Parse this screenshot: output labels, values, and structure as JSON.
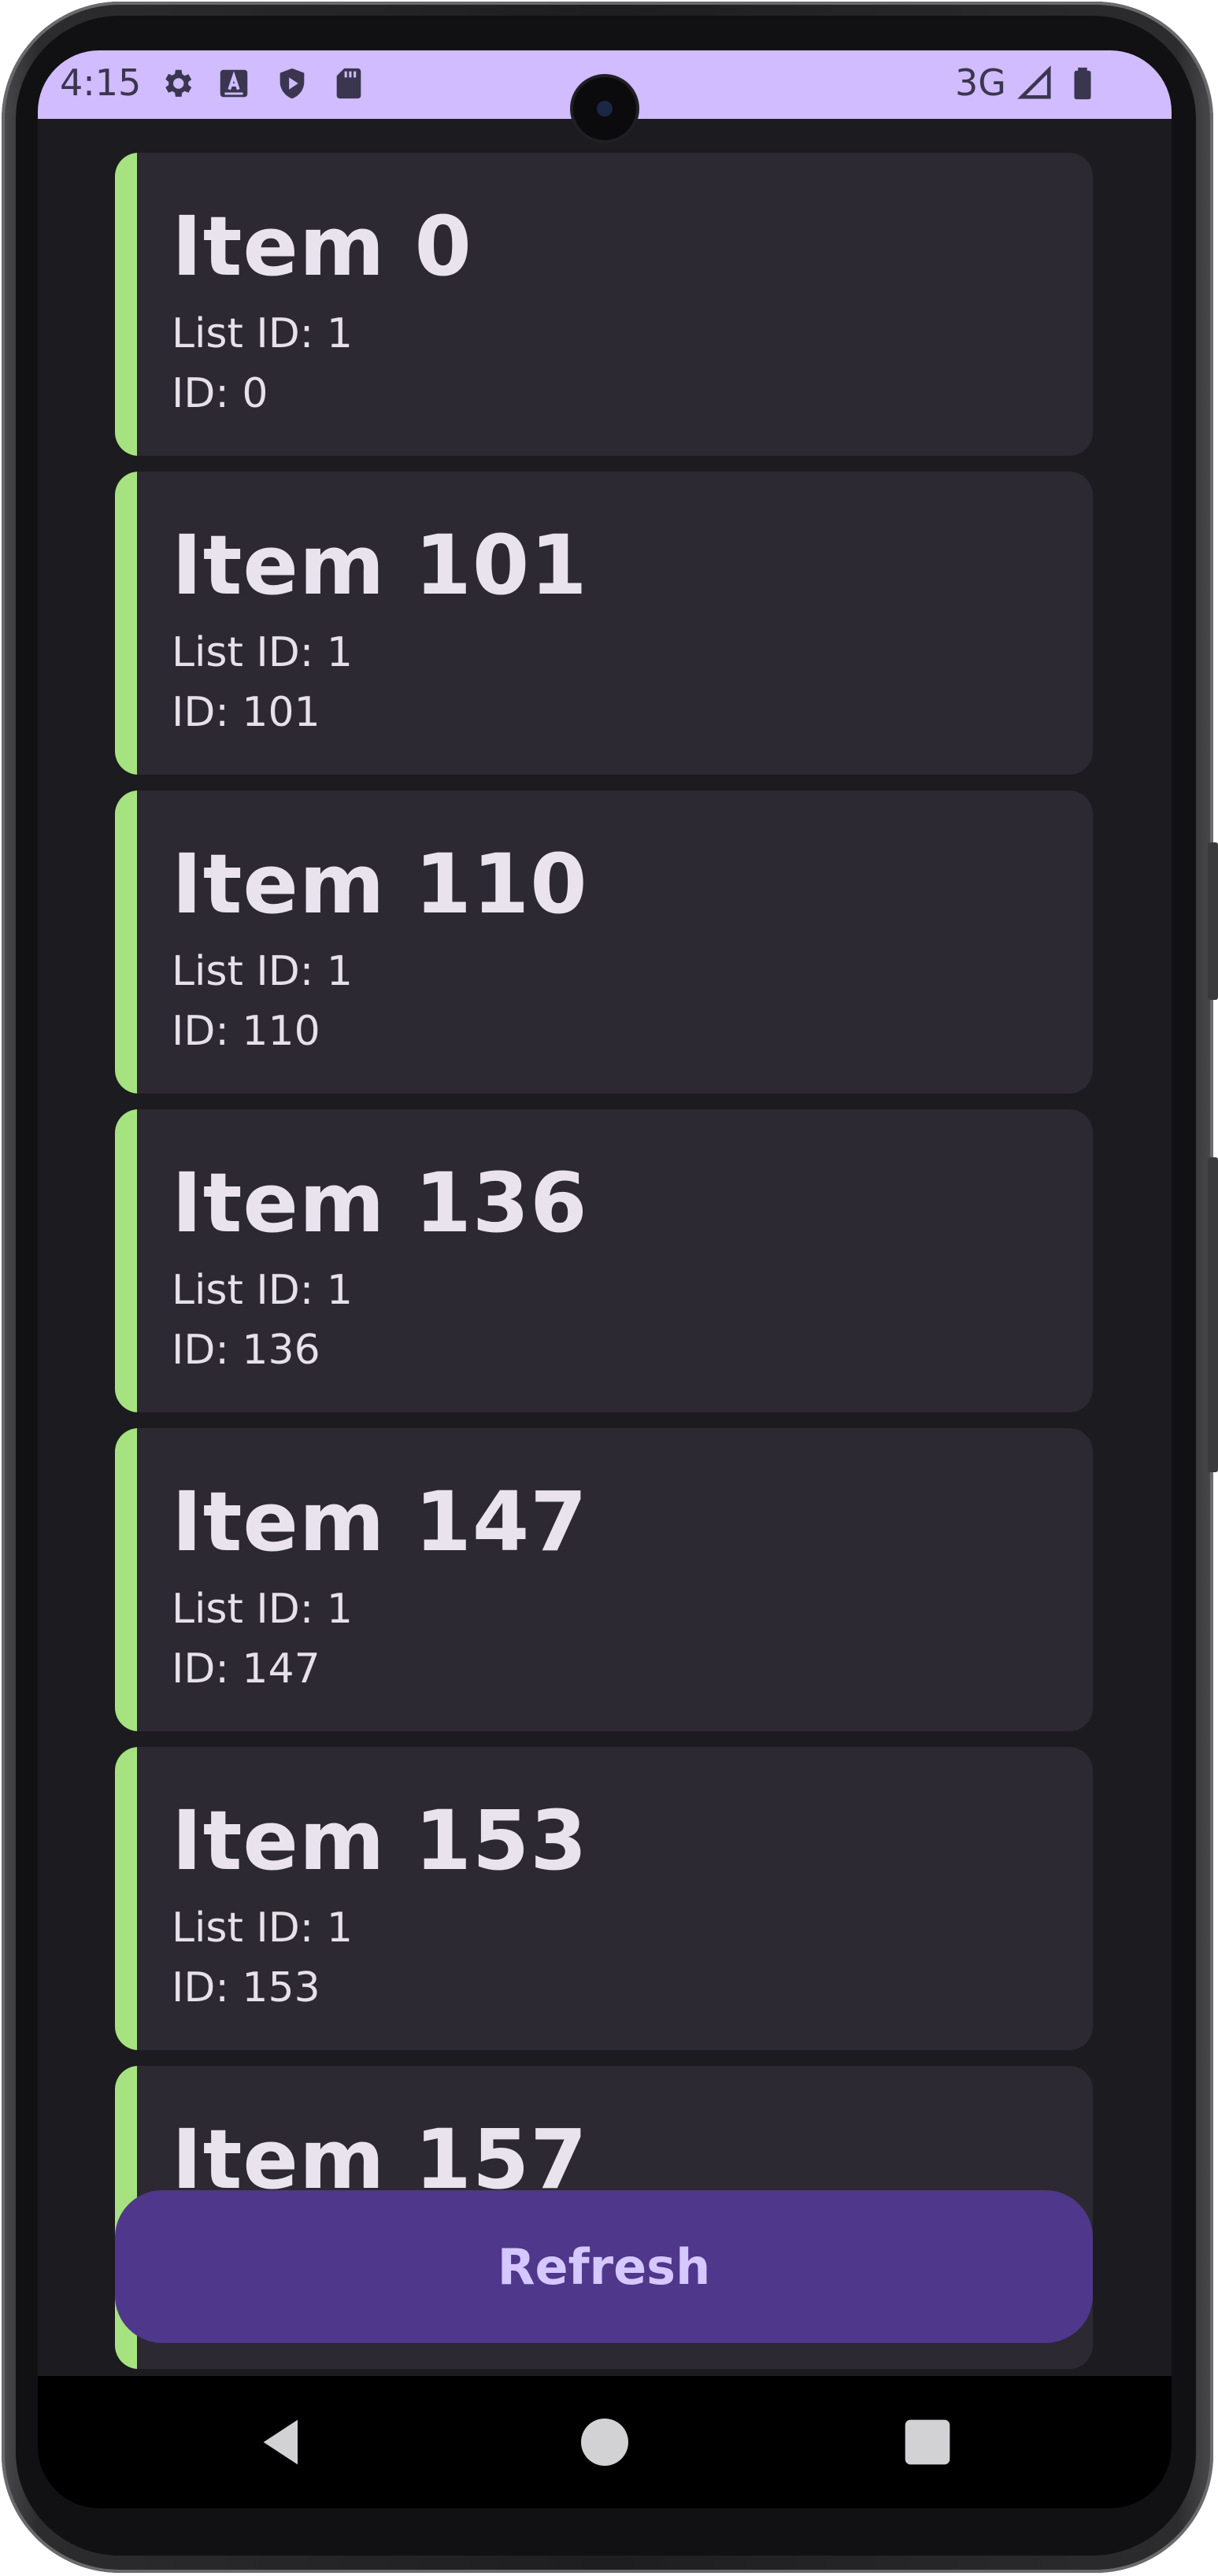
{
  "status_bar": {
    "time": "4:15",
    "network": "3G",
    "icons": [
      "settings-icon",
      "keyboard-a-icon",
      "play-protect-icon",
      "sd-card-icon",
      "signal-icon",
      "battery-icon"
    ],
    "background": "#d0bcff"
  },
  "items": [
    {
      "title": "Item 0",
      "list_id": "List ID: 1",
      "id": "ID: 0"
    },
    {
      "title": "Item 101",
      "list_id": "List ID: 1",
      "id": "ID: 101"
    },
    {
      "title": "Item 110",
      "list_id": "List ID: 1",
      "id": "ID: 110"
    },
    {
      "title": "Item 136",
      "list_id": "List ID: 1",
      "id": "ID: 136"
    },
    {
      "title": "Item 147",
      "list_id": "List ID: 1",
      "id": "ID: 147"
    },
    {
      "title": "Item 153",
      "list_id": "List ID: 1",
      "id": "ID: 153"
    },
    {
      "title": "Item 157",
      "list_id": "",
      "id": ""
    }
  ],
  "refresh_button": {
    "label": "Refresh",
    "color": "#4f378b"
  },
  "colors": {
    "background": "#1c1b20",
    "card": "#2c2932",
    "accent": "#a6e27f"
  },
  "nav_bar": {
    "icons": [
      "back-icon",
      "home-icon",
      "recents-icon"
    ]
  }
}
